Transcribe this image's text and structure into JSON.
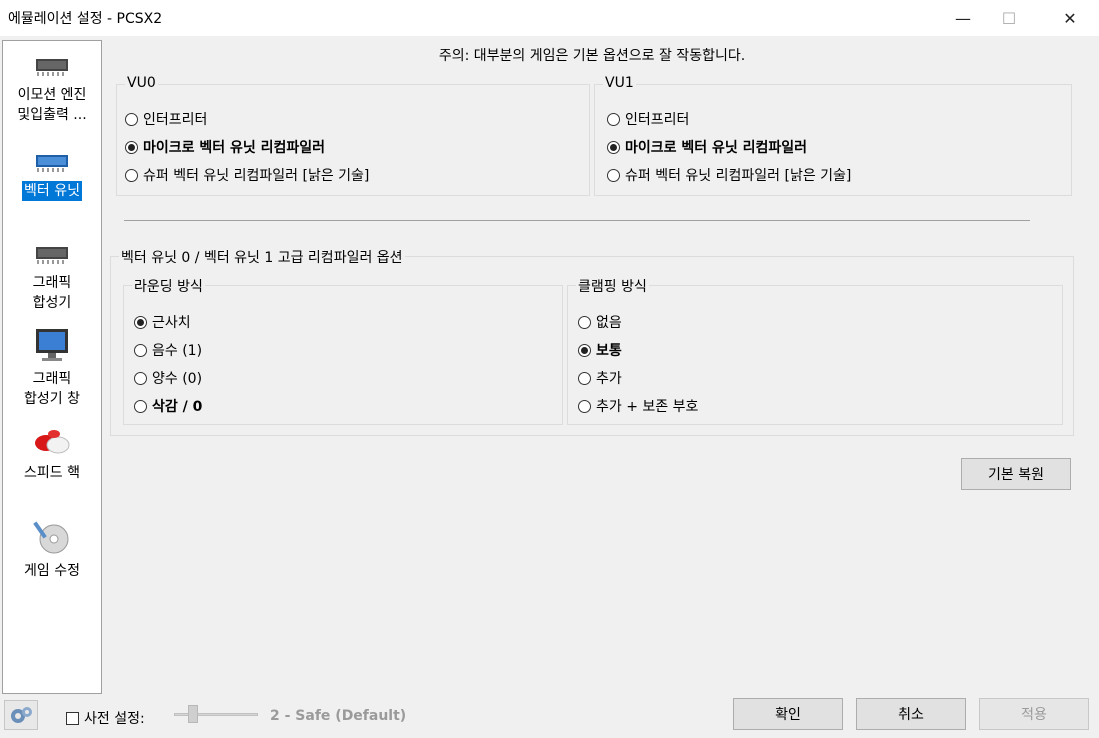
{
  "window": {
    "title": "에뮬레이션 설정 - PCSX2",
    "min_symbol": "—",
    "max_symbol": "☐",
    "close_symbol": "✕"
  },
  "sidebar": {
    "items": [
      {
        "label1": "이모션 엔진",
        "label2": "및입출력 ...",
        "icon": "chip-icon"
      },
      {
        "label1": "벡터 유닛",
        "label2": "",
        "icon": "chip-blue-icon",
        "selected": true
      },
      {
        "label1": "그래픽",
        "label2": "합성기",
        "icon": "chip-icon"
      },
      {
        "label1": "그래픽",
        "label2": "합성기 창",
        "icon": "monitor-icon"
      },
      {
        "label1": "스피드 핵",
        "label2": "",
        "icon": "pill-icon"
      },
      {
        "label1": "게임 수정",
        "label2": "",
        "icon": "disc-icon"
      }
    ]
  },
  "notice": "주의: 대부분의 게임은 기본 옵션으로 잘 작동합니다.",
  "vu0": {
    "title": "VU0",
    "options": [
      "인터프리터",
      "마이크로 벡터 유닛 리컴파일러",
      "슈퍼 벡터 유닛 리컴파일러 [낡은 기술]"
    ],
    "selected": 1
  },
  "vu1": {
    "title": "VU1",
    "options": [
      "인터프리터",
      "마이크로 벡터 유닛 리컴파일러",
      "슈퍼 벡터 유닛 리컴파일러 [낡은 기술]"
    ],
    "selected": 1
  },
  "advanced": {
    "title": "벡터 유닛 0 / 벡터 유닛 1 고급 리컴파일러 옵션",
    "rounding": {
      "title": "라운딩 방식",
      "options": [
        "근사치",
        "음수 (1)",
        "양수 (0)",
        "삭감 / 0"
      ],
      "selected": 0
    },
    "clamping": {
      "title": "클램핑 방식",
      "options": [
        "없음",
        "보통",
        "추가",
        "추가 + 보존 부호"
      ],
      "selected": 1
    }
  },
  "restore_button": "기본 복원",
  "bottom": {
    "preset_checkbox": "사전 설정:",
    "preset_checked": false,
    "preset_value": "2 - Safe (Default)",
    "ok": "확인",
    "cancel": "취소",
    "apply": "적용"
  }
}
